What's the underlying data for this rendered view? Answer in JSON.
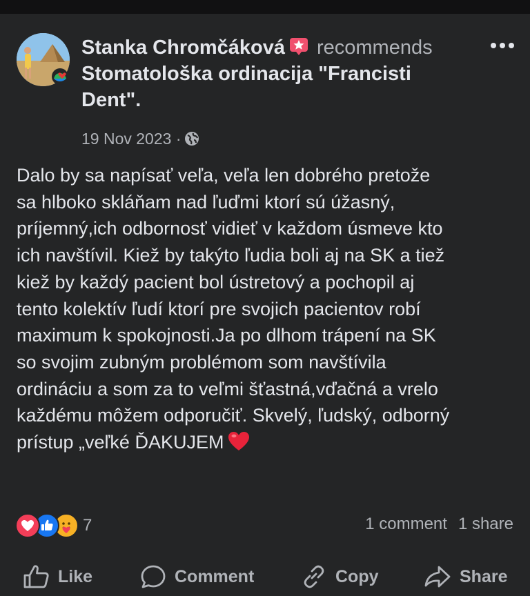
{
  "post": {
    "author": "Stanka Chromčáková",
    "action_word": "recommends",
    "page_line1": "Stomatološka ordinacija \"Francisti",
    "page_line2": "Dent\".",
    "date": "19 Nov 2023",
    "separator": "·",
    "audience_icon": "globe-icon",
    "body": "Dalo by sa napísať veľa, veľa len dobrého  pretože\nsa hlboko skláňam nad ľuďmi ktorí sú úžasný,\npríjemný,ich  odbornosť vidieť v každom úsmeve kto\nich navštívil. Kiež by takýto ľudia boli aj na SK a tiež\nkiež by každý pacient bol ústretový a pochopil aj\ntento kolektív ľudí ktorí pre svojich pacientov robí\nmaximum k spokojnosti.Ja po dlhom trápení na SK\nso svojim zubným problémom som navštívila\nordináciu a som za to veľmi šťastná,vďačná a vrelo\nkaždému môžem odporučiť. Skvelý, ľudský, odborný\nprístup „veľké ĎAKUJEM",
    "body_end_emoji": "red-heart"
  },
  "engagement": {
    "reaction_icons": [
      "love-reaction",
      "like-reaction",
      "care-reaction"
    ],
    "reaction_count": "7",
    "comments": "1 comment",
    "shares": "1 share"
  },
  "actions": {
    "like": "Like",
    "comment": "Comment",
    "copy": "Copy",
    "share": "Share"
  },
  "colors": {
    "background": "#242526",
    "text": "#e4e6eb",
    "secondary_text": "#b0b3b8",
    "love": "#f33e58",
    "like": "#1877f2",
    "care": "#f7b125"
  }
}
